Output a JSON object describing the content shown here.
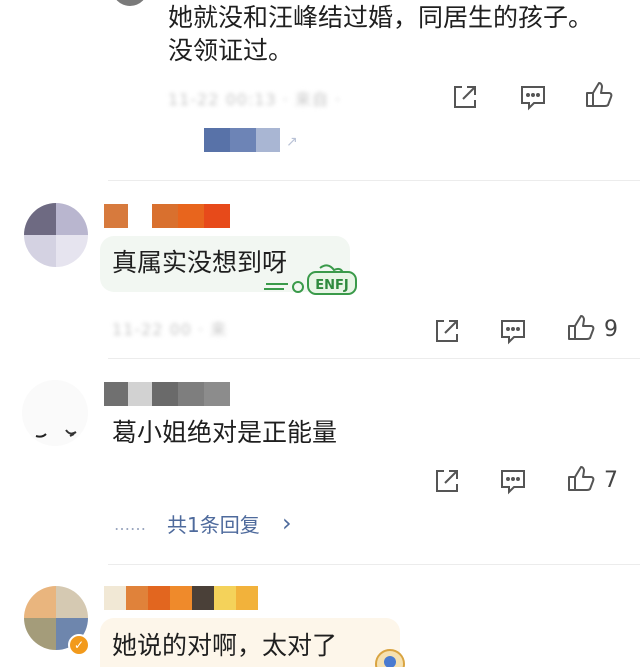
{
  "comments": [
    {
      "text_line1": "她就没和汪峰结过婚，同居生的孩子。",
      "text_line2": "没领证过。",
      "like_count": ""
    },
    {
      "text": "真属实没想到呀",
      "sticker_text": "ENFJ",
      "like_count": "9"
    },
    {
      "text": "葛小姐绝对是正能量",
      "like_count": "7",
      "replies_label": "共1条回复",
      "replies_chevron": "›",
      "replies_dots": "……"
    },
    {
      "text": "她说的对啊，太对了"
    }
  ],
  "colors": {
    "link": "#4e6a9c",
    "icon": "#555555",
    "divider": "#ececec"
  }
}
